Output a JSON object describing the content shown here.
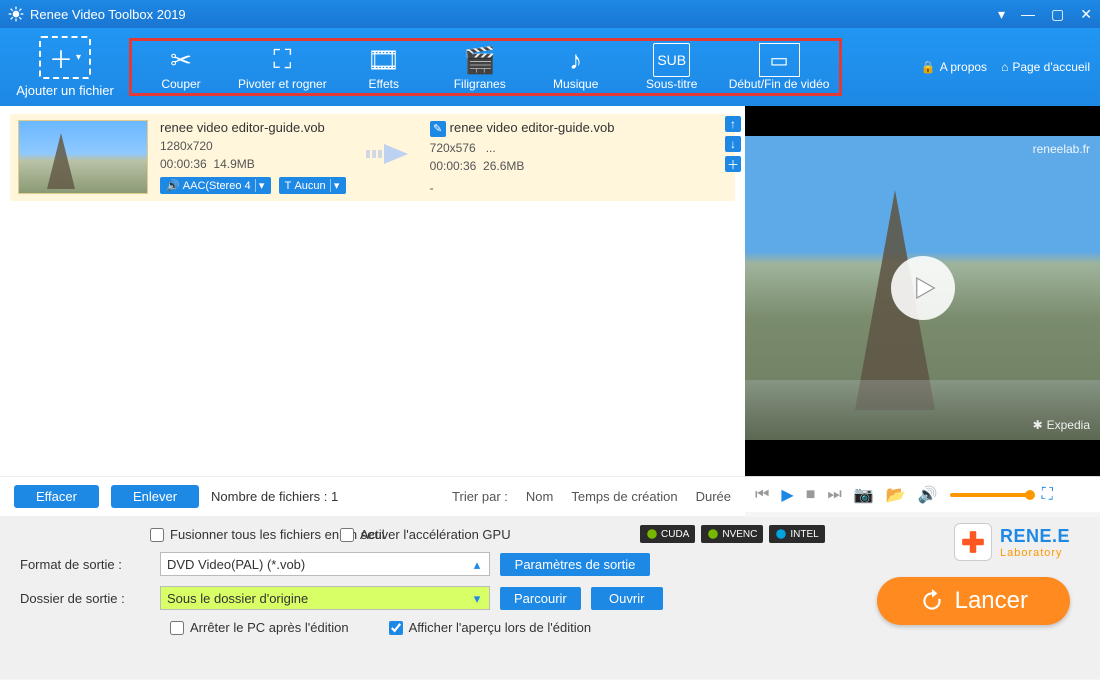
{
  "app": {
    "title": "Renee Video Toolbox 2019"
  },
  "ribbon": {
    "add_file": "Ajouter un fichier",
    "items": [
      {
        "label": "Couper",
        "icon": "✂"
      },
      {
        "label": "Pivoter et rogner",
        "icon": "⛶"
      },
      {
        "label": "Effets",
        "icon": "🎞"
      },
      {
        "label": "Filigranes",
        "icon": "🎬"
      },
      {
        "label": "Musique",
        "icon": "♪"
      },
      {
        "label": "Sous-titre",
        "icon": "SUB"
      },
      {
        "label": "Début/Fin de vidéo",
        "icon": "▭"
      }
    ],
    "about": "A propos",
    "home": "Page d'accueil"
  },
  "file": {
    "in": {
      "name": "renee video editor-guide.vob",
      "res": "1280x720",
      "dur": "00:00:36",
      "size": "14.9MB",
      "audio_pill": "AAC(Stereo 4",
      "text_pill": "Aucun"
    },
    "out": {
      "name": "renee video editor-guide.vob",
      "res": "720x576",
      "res_extra": "...",
      "dur": "00:00:36",
      "size": "26.6MB",
      "dash": "-"
    }
  },
  "list_ctrl": {
    "clear": "Effacer",
    "remove": "Enlever",
    "count_label": "Nombre de fichiers : 1",
    "sort_label": "Trier par :",
    "sort_name": "Nom",
    "sort_time": "Temps de création",
    "sort_dur": "Durée"
  },
  "settings": {
    "merge": "Fusionner tous les fichiers en un seul",
    "gpu": "Activer l'accélération GPU",
    "badges": [
      "CUDA",
      "NVENC",
      "INTEL"
    ],
    "format_label": "Format de sortie :",
    "format_value": "DVD Video(PAL) (*.vob)",
    "format_btn": "Paramètres de sortie",
    "folder_label": "Dossier de sortie :",
    "folder_value": "Sous le dossier d'origine",
    "browse": "Parcourir",
    "open": "Ouvrir",
    "shutdown": "Arrêter le PC après l'édition",
    "preview_chk": "Afficher l'aperçu lors de l'édition"
  },
  "preview": {
    "wm_tl": "reneelab.fr",
    "wm_br": "Expedia"
  },
  "brand": {
    "l1": "RENE.E",
    "l2": "Laboratory"
  },
  "launch": {
    "label": "Lancer"
  }
}
